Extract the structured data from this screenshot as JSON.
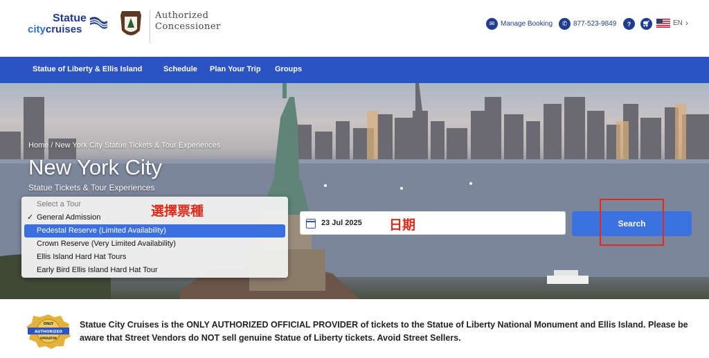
{
  "header": {
    "logo_line1": "Statue",
    "logo_line2_a": "city",
    "logo_line2_b": "cruises",
    "authorized_line1": "Authorized",
    "authorized_line2": "Concessioner",
    "manage_booking": "Manage Booking",
    "phone": "877-523-9849",
    "help_icon_text": "?",
    "language": "EN"
  },
  "nav": {
    "items": [
      {
        "label": "Statue of Liberty & Ellis Island"
      },
      {
        "label": "Schedule"
      },
      {
        "label": "Plan Your Trip"
      },
      {
        "label": "Groups"
      }
    ]
  },
  "hero": {
    "breadcrumb": "Home / New York City Statue Tickets & Tour Experiences",
    "title": "New York City",
    "subtitle": "Statue Tickets & Tour Experiences"
  },
  "tour_select": {
    "placeholder": "Select a Tour",
    "options": [
      {
        "label": "General Admission",
        "selected": true
      },
      {
        "label": "Pedestal Reserve (Limited Availability)",
        "highlighted": true
      },
      {
        "label": "Crown Reserve (Very Limited Availability)"
      },
      {
        "label": "Ellis Island Hard Hat Tours"
      },
      {
        "label": "Early Bird Ellis Island Hard Hat Tour"
      }
    ],
    "annotation": "選擇票種"
  },
  "date": {
    "value": "23 Jul 2025",
    "annotation": "日期"
  },
  "search": {
    "label": "Search"
  },
  "notice": {
    "badge_top": "ONLY",
    "badge_mid": "AUTHORIZED",
    "badge_bottom": "OPERATOR",
    "text": "Statue City Cruises is the ONLY AUTHORIZED OFFICIAL PROVIDER of tickets to the Statue of Liberty National Monument and Ellis Island. Please be aware that Street Vendors do NOT sell genuine Statue of Liberty tickets. Avoid Street Sellers."
  },
  "colors": {
    "brand_blue": "#1f3c8f",
    "nav_blue": "#2b53c4",
    "button_blue": "#3b72e0",
    "annotation_red": "#e02b1a"
  }
}
